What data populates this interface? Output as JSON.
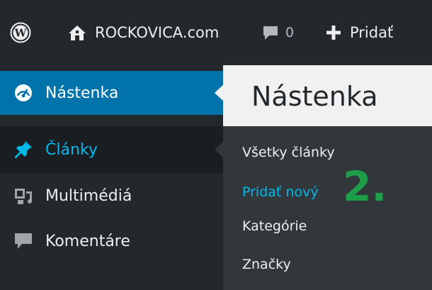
{
  "admin_bar": {
    "wp_logo_icon": "wordpress-logo-icon",
    "site_icon": "home-icon",
    "site_name": "ROCKOVICA.com",
    "comments_icon": "comment-bubble-icon",
    "comments_count": "0",
    "new_icon": "plus-icon",
    "new_label": "Pridať"
  },
  "sidebar": {
    "items": [
      {
        "label": "Nástenka",
        "icon": "dashboard-gauge-icon",
        "state": "current"
      },
      {
        "label": "Články",
        "icon": "pushpin-icon",
        "state": "hover"
      },
      {
        "label": "Multimédiá",
        "icon": "media-icon",
        "state": "normal"
      },
      {
        "label": "Komentáre",
        "icon": "comment-bubble-icon",
        "state": "normal"
      }
    ]
  },
  "page": {
    "title": "Nástenka"
  },
  "submenu": {
    "items": [
      {
        "label": "Všetky články",
        "state": "normal"
      },
      {
        "label": "Pridať nový",
        "state": "active"
      },
      {
        "label": "Kategórie",
        "state": "normal"
      },
      {
        "label": "Značky",
        "state": "normal"
      }
    ]
  },
  "annotation": {
    "text": "2.",
    "color": "#1e9e48"
  },
  "colors": {
    "admin_bar_bg": "#23282d",
    "menu_current_bg": "#0073aa",
    "menu_highlight_text": "#00b9eb",
    "submenu_bg": "#32373c",
    "content_bg": "#f1f1f1"
  }
}
